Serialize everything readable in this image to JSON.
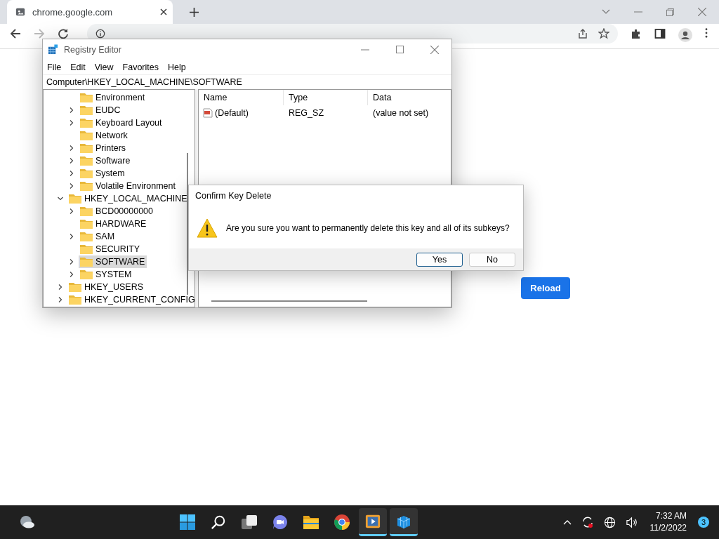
{
  "browser": {
    "tab": {
      "title": "chrome.google.com",
      "selected": true
    },
    "reload_button": "Reload"
  },
  "registry_editor": {
    "title": "Registry Editor",
    "menu": [
      "File",
      "Edit",
      "View",
      "Favorites",
      "Help"
    ],
    "path": "Computer\\HKEY_LOCAL_MACHINE\\SOFTWARE",
    "tree": [
      {
        "children": [
          {
            "label": "Environment",
            "expandable": false,
            "selected": false
          },
          {
            "label": "EUDC",
            "expandable": true,
            "expanded": false,
            "selected": false
          },
          {
            "label": "Keyboard Layout",
            "expandable": true,
            "expanded": false,
            "selected": false
          },
          {
            "label": "Network",
            "expandable": false,
            "selected": false
          },
          {
            "label": "Printers",
            "expandable": true,
            "expanded": false,
            "selected": false
          },
          {
            "label": "Software",
            "expandable": true,
            "expanded": false,
            "selected": false
          },
          {
            "label": "System",
            "expandable": true,
            "expanded": false,
            "selected": false
          },
          {
            "label": "Volatile Environment",
            "expandable": true,
            "expanded": false,
            "selected": false
          }
        ]
      },
      {
        "label": "HKEY_LOCAL_MACHINE",
        "expandable": true,
        "expanded": true,
        "selected": false,
        "children": [
          {
            "label": "BCD00000000",
            "expandable": true,
            "expanded": false,
            "selected": false
          },
          {
            "label": "HARDWARE",
            "expandable": false,
            "selected": false
          },
          {
            "label": "SAM",
            "expandable": true,
            "expanded": false,
            "selected": false
          },
          {
            "label": "SECURITY",
            "expandable": false,
            "selected": false
          },
          {
            "label": "SOFTWARE",
            "expandable": true,
            "expanded": false,
            "selected": true
          },
          {
            "label": "SYSTEM",
            "expandable": true,
            "expanded": false,
            "selected": false
          }
        ]
      },
      {
        "label": "HKEY_USERS",
        "expandable": true,
        "expanded": false,
        "selected": false
      },
      {
        "label": "HKEY_CURRENT_CONFIG",
        "expandable": true,
        "expanded": false,
        "selected": false
      }
    ],
    "columns": [
      "Name",
      "Type",
      "Data"
    ],
    "values": [
      {
        "name": "(Default)",
        "type": "REG_SZ",
        "data": "(value not set)"
      }
    ]
  },
  "dialog": {
    "title": "Confirm Key Delete",
    "message": "Are you sure you want to permanently delete this key and all of its subkeys?",
    "buttons": [
      {
        "label": "Yes",
        "focused": true
      },
      {
        "label": "No",
        "focused": false
      }
    ]
  },
  "taskbar": {
    "apps": [
      {
        "kind": "start",
        "active": false
      },
      {
        "kind": "search",
        "active": false
      },
      {
        "kind": "taskview",
        "active": false
      },
      {
        "kind": "chat",
        "active": false
      },
      {
        "kind": "explorer",
        "active": false
      },
      {
        "kind": "chrome",
        "active": false
      },
      {
        "kind": "media",
        "active": true
      },
      {
        "kind": "regedit",
        "active": true
      }
    ],
    "time": "7:32 AM",
    "date": "11/2/2022",
    "notifications": "3"
  }
}
